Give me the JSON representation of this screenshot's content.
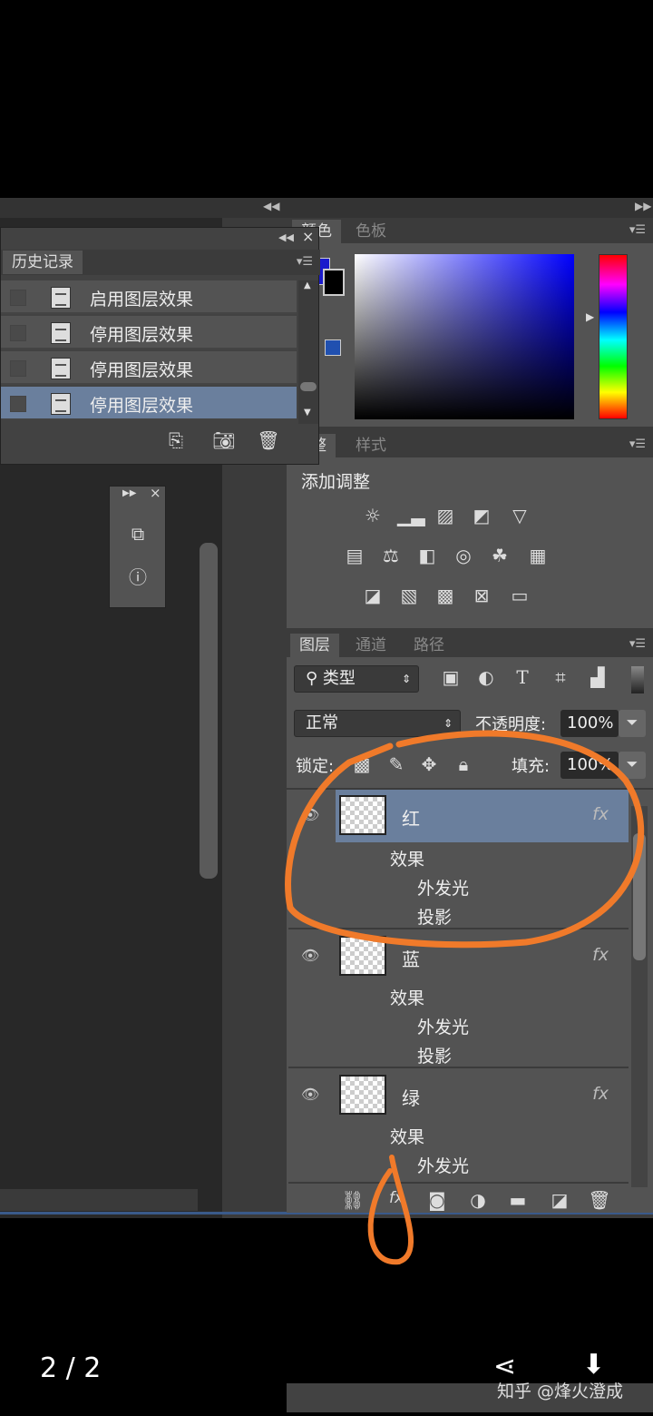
{
  "viewer": {
    "page_counter": "2 / 2",
    "watermark": "知乎 @烽火澄成"
  },
  "history": {
    "tab": "历史记录",
    "items": [
      {
        "label": "启用图层效果",
        "selected": false
      },
      {
        "label": "停用图层效果",
        "selected": false
      },
      {
        "label": "停用图层效果",
        "selected": false
      },
      {
        "label": "停用图层效果",
        "selected": true
      }
    ]
  },
  "color_panel": {
    "tabs": [
      "颜色",
      "色板"
    ],
    "foreground": "#1a1acc",
    "background": "#000000",
    "hue": "#0000ff"
  },
  "adjustments": {
    "tabs": [
      "调整",
      "样式"
    ],
    "title": "添加调整"
  },
  "layers": {
    "tabs": [
      "图层",
      "通道",
      "路径"
    ],
    "filter": "类型",
    "blend_mode": "正常",
    "opacity_label": "不透明度:",
    "opacity": "100%",
    "lock_label": "锁定:",
    "fill_label": "填充:",
    "fill": "100%",
    "items": [
      {
        "name": "红",
        "selected": true,
        "effects_label": "效果",
        "effects": [
          "外发光",
          "投影"
        ]
      },
      {
        "name": "蓝",
        "selected": false,
        "effects_label": "效果",
        "effects": [
          "外发光",
          "投影"
        ]
      },
      {
        "name": "绿",
        "selected": false,
        "effects_label": "效果",
        "effects": [
          "外发光"
        ]
      }
    ],
    "fx": "fx"
  },
  "annotation_color": "#f07a2a"
}
